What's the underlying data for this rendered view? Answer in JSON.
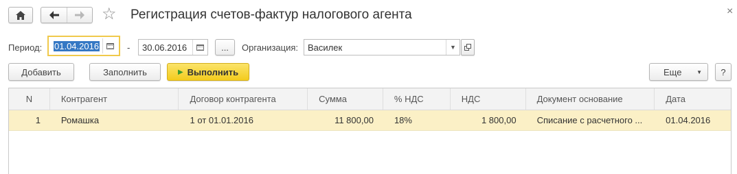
{
  "window": {
    "title": "Регистрация счетов-фактур налогового агента",
    "close_glyph": "×"
  },
  "filters": {
    "period_label": "Период:",
    "date_from": "01.04.2016",
    "separator": "-",
    "date_to": "30.06.2016",
    "more_dots": "...",
    "org_label": "Организация:",
    "org_value": "Василек"
  },
  "toolbar": {
    "add_label": "Добавить",
    "fill_label": "Заполнить",
    "run_label": "Выполнить",
    "more_label": "Еще",
    "help_label": "?"
  },
  "table": {
    "columns": [
      "N",
      "Контрагент",
      "Договор контрагента",
      "Сумма",
      "% НДС",
      "НДС",
      "Документ основание",
      "Дата"
    ],
    "rows": [
      [
        "1",
        "Ромашка",
        "1 от 01.01.2016",
        "11 800,00",
        "18%",
        "1 800,00",
        "Списание с расчетного ...",
        "01.04.2016"
      ]
    ]
  },
  "icons": [
    "home-icon",
    "back-arrow-icon",
    "forward-arrow-icon",
    "star-icon",
    "close-icon",
    "calendar-icon",
    "dropdown-icon",
    "open-icon",
    "play-icon"
  ],
  "colors": {
    "run_button": "#f3cc1d",
    "selected_row": "#fbf0c6",
    "focus_border": "#f0c94b"
  }
}
